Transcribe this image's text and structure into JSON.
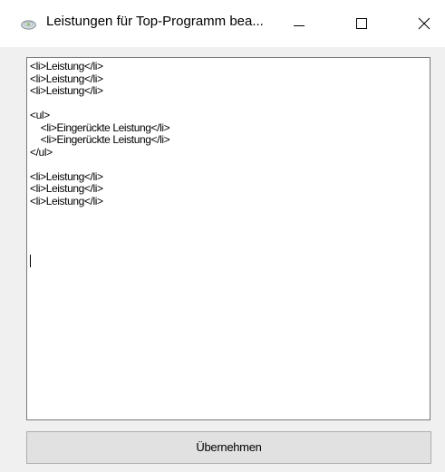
{
  "window": {
    "title": "Leistungen für Top-Programm bea...",
    "icon": "drive-icon"
  },
  "titlebar_buttons": {
    "minimize": "minimize-icon",
    "maximize": "maximize-icon",
    "close": "close-icon"
  },
  "editor": {
    "lines": [
      "<li>Leistung</li>",
      "<li>Leistung</li>",
      "<li>Leistung</li>",
      "",
      "<ul>",
      "    <li>Eingerückte Leistung</li>",
      "    <li>Eingerückte Leistung</li>",
      "</ul>",
      "",
      "<li>Leistung</li>",
      "<li>Leistung</li>",
      "<li>Leistung</li>"
    ]
  },
  "footer": {
    "apply_label": "Übernehmen"
  }
}
